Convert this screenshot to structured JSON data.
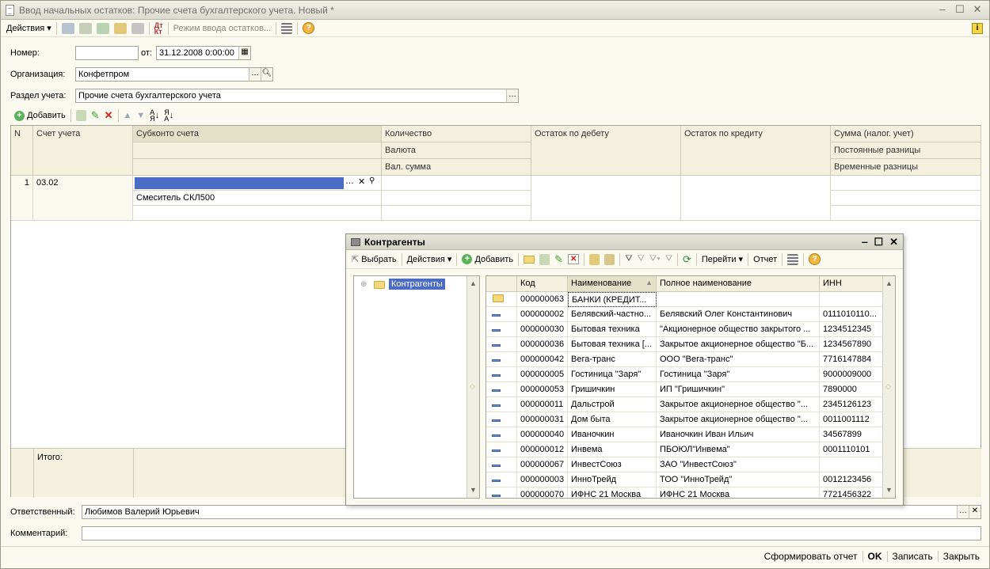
{
  "window": {
    "title": "Ввод начальных остатков: Прочие счета бухгалтерского учета. Новый *"
  },
  "toolbar": {
    "actions": "Действия",
    "mode": "Режим ввода остатков..."
  },
  "form": {
    "number_label": "Номер:",
    "number_value": "",
    "from_label": "от:",
    "date_value": "31.12.2008  0:00:00",
    "org_label": "Организация:",
    "org_value": "Конфетпром",
    "section_label": "Раздел учета:",
    "section_value": "Прочие счета бухгалтерского учета"
  },
  "grid_toolbar": {
    "add": "Добавить"
  },
  "grid": {
    "headers": {
      "n": "N",
      "account": "Счет учета",
      "subkonto": "Субконто счета",
      "quantity": "Количество",
      "currency": "Валюта",
      "cur_sum": "Вал. сумма",
      "debit": "Остаток по дебету",
      "credit": "Остаток по кредиту",
      "tax_sum": "Сумма (налог. учет)",
      "perm_diff": "Постоянные разницы",
      "temp_diff": "Временные разницы"
    },
    "row": {
      "n": "1",
      "account": "03.02",
      "subkonto2": "Смеситель СКЛ500"
    },
    "total_label": "Итого:"
  },
  "responsible": {
    "label": "Ответственный:",
    "value": "Любимов Валерий Юрьевич"
  },
  "comment": {
    "label": "Комментарий:",
    "value": ""
  },
  "bottom": {
    "report": "Сформировать отчет",
    "ok": "OK",
    "save": "Записать",
    "close": "Закрыть"
  },
  "popup": {
    "title": "Контрагенты",
    "toolbar": {
      "select": "Выбрать",
      "actions": "Действия",
      "add": "Добавить",
      "goto": "Перейти",
      "report": "Отчет"
    },
    "tree_root": "Контрагенты",
    "columns": {
      "code": "Код",
      "name": "Наименование",
      "full_name": "Полное наименование",
      "inn": "ИНН"
    },
    "rows": [
      {
        "code": "000000063",
        "name": "БАНКИ (КРЕДИТ...",
        "full": "",
        "inn": "",
        "folder": true
      },
      {
        "code": "000000002",
        "name": "Белявский-частно...",
        "full": "Белявский Олег Константинович",
        "inn": "0111010110..."
      },
      {
        "code": "000000030",
        "name": "Бытовая техника",
        "full": " \"Акционерное общество закрытого ...",
        "inn": "1234512345"
      },
      {
        "code": "000000036",
        "name": "Бытовая техника [...",
        "full": "Закрытое акционерное общество \"Б...",
        "inn": "1234567890"
      },
      {
        "code": "000000042",
        "name": "Вега-транс",
        "full": "ООО \"Вега-транс\"",
        "inn": "7716147884"
      },
      {
        "code": "000000005",
        "name": "Гостиница \"Заря\"",
        "full": "Гостиница \"Заря\"",
        "inn": "9000009000"
      },
      {
        "code": "000000053",
        "name": "Гришичкин",
        "full": "ИП \"Гришичкин\"",
        "inn": "7890000"
      },
      {
        "code": "000000011",
        "name": "Дальстрой",
        "full": "Закрытое акционерное общество \"...",
        "inn": "2345126123"
      },
      {
        "code": "000000031",
        "name": "Дом быта",
        "full": "Закрытое акционерное общество \"...",
        "inn": "0011001112"
      },
      {
        "code": "000000040",
        "name": "Иваночкин",
        "full": "Иваночкин Иван Ильич",
        "inn": "34567899"
      },
      {
        "code": "000000012",
        "name": "Инвема",
        "full": "ПБОЮЛ\"Инвема\"",
        "inn": "0001110101"
      },
      {
        "code": "000000067",
        "name": "ИнвестСоюз",
        "full": "ЗАО \"ИнвестСоюз\"",
        "inn": ""
      },
      {
        "code": "000000003",
        "name": "ИнноТрейд",
        "full": "ТОО \"ИнноТрейд\"",
        "inn": "0012123456"
      },
      {
        "code": "000000070",
        "name": "ИФНС 21 Москва",
        "full": "ИФНС 21 Москва",
        "inn": "7721456322"
      }
    ]
  }
}
